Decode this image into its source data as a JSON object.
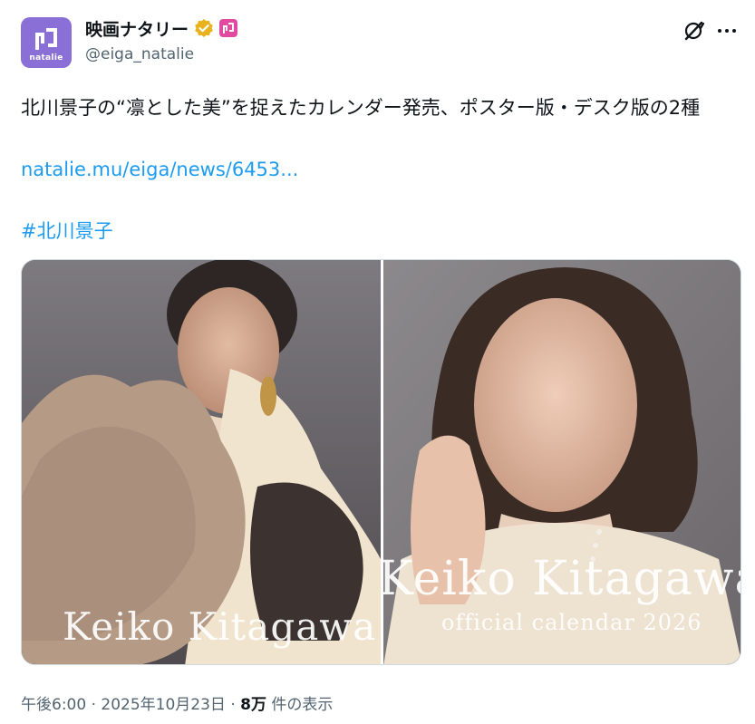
{
  "account": {
    "display_name": "映画ナタリー",
    "handle": "@eiga_natalie",
    "avatar_brand": "natalie",
    "verified_color": "#e8b21c",
    "affiliate_color": "#e24aa1"
  },
  "tweet": {
    "text": "北川景子の“凛とした美”を捉えたカレンダー発売、ポスター版・デスク版の2種",
    "link": "natalie.mu/eiga/news/6453...",
    "hashtag": "#北川景子",
    "link_color": "#1d9bf0"
  },
  "media": {
    "left_caption": "Keiko Kitagawa",
    "right_caption": "Keiko Kitagawa",
    "right_subcaption": "official calendar 2026"
  },
  "meta": {
    "time": "午後6:00",
    "separator": "·",
    "date": "2025年10月23日",
    "views": "8万",
    "views_label": "件の表示"
  },
  "icons": [
    "natalie-logo-icon",
    "verified-badge-icon",
    "affiliate-badge-icon",
    "grok-icon",
    "more-icon"
  ]
}
